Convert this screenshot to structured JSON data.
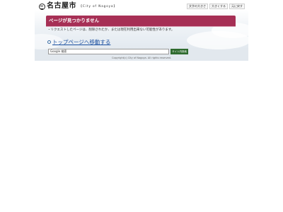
{
  "header": {
    "logo_text": "名古屋市",
    "logo_sub": "【City of Nagoya】",
    "util_buttons": [
      "文字の大きさ",
      "大きくする",
      "元に戻す"
    ]
  },
  "main": {
    "title": "ページが見つかりません",
    "message": "・リクエストしたページは、削除されたか、または現在利用出来ない可能性があります。",
    "top_link": "トップページへ移動する"
  },
  "search": {
    "value": "Google 検索",
    "button_label": "サイト内検索"
  },
  "footer": {
    "copyright": "Copyright(c) City of Nagoya. All rights reserved."
  },
  "colors": {
    "title_bar": "#a62f55",
    "link": "#1a4fa0",
    "search_button": "#2f6b2f"
  }
}
